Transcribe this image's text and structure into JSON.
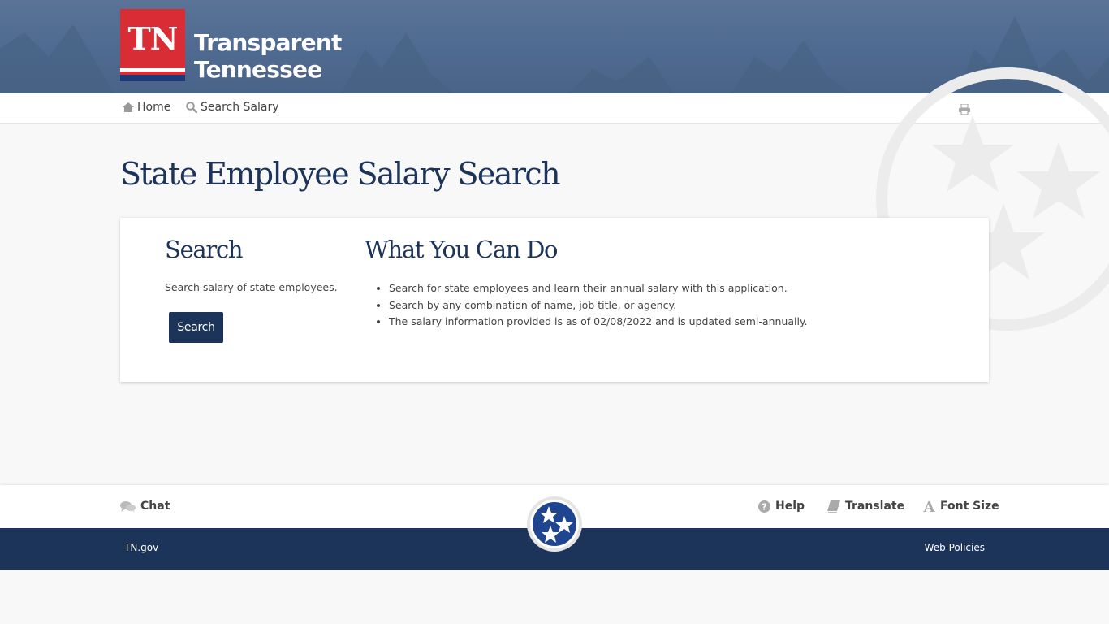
{
  "header": {
    "logo_mark": "TN",
    "logo_line1": "Transparent",
    "logo_line2": "Tennessee",
    "colors": {
      "logo_red": "#d92d35",
      "logo_blue": "#1b3a76",
      "banner": "#4f6a90"
    }
  },
  "nav": {
    "items": [
      {
        "label": "Home",
        "icon": "home-icon"
      },
      {
        "label": "Search Salary",
        "icon": "search-icon"
      }
    ],
    "print_icon": "print-icon"
  },
  "page": {
    "title": "State Employee Salary Search"
  },
  "card": {
    "search": {
      "heading": "Search",
      "description": "Search salary of state employees.",
      "button_label": "Search"
    },
    "what": {
      "heading": "What You Can Do",
      "items": [
        "Search for state employees and learn their annual salary with this application.",
        "Search by any combination of name, job title, or agency.",
        "The salary information provided is as of 02/08/2022 and is updated semi-annually."
      ]
    }
  },
  "footer": {
    "chat": "Chat",
    "help": "Help",
    "translate": "Translate",
    "font_size": "Font Size",
    "links": {
      "tngov": "TN.gov",
      "policies": "Web Policies"
    },
    "colors": {
      "navy": "#1c3459"
    }
  }
}
